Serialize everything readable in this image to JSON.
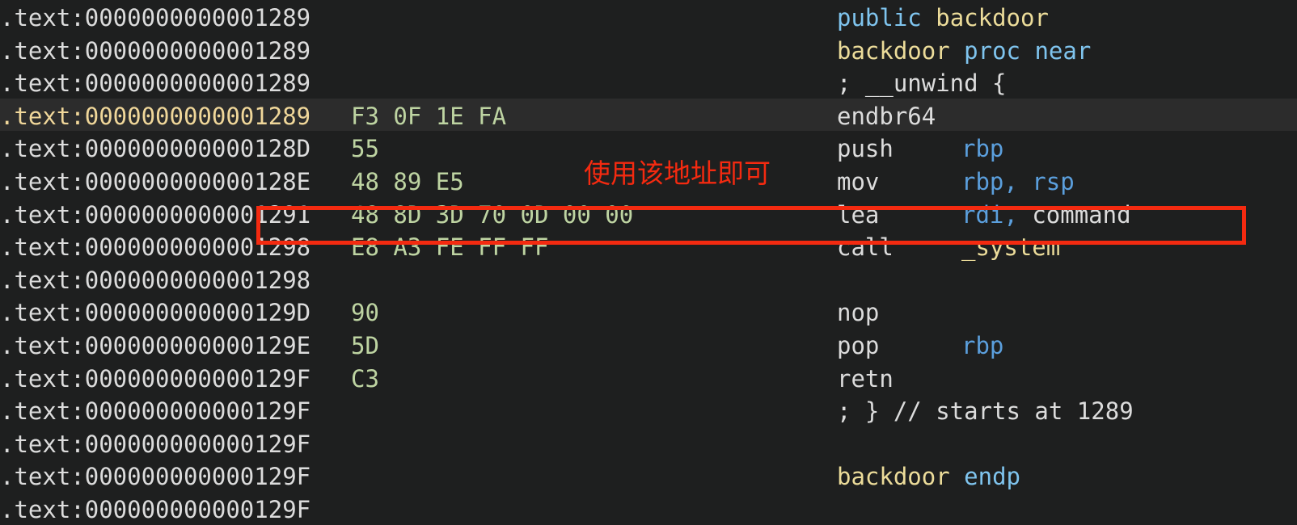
{
  "app": {
    "title": "IDA Pro disassembly view",
    "background_color": "#1e1f1f",
    "highlight_row_color": "#2c2c2c"
  },
  "annotation": {
    "text": "使用该地址即可",
    "color": "#f42a10",
    "box_color": "#f42a10",
    "box_target_line_index": 6
  },
  "colors": {
    "address": "#dcdcdc",
    "address_highlighted": "#f0d79a",
    "bytes": "#bed4a2",
    "keyword": "#7fc4ee",
    "symbol_name": "#ecdc9a",
    "register": "#5b9fdd",
    "plain": "#dcdcdc"
  },
  "listing": {
    "segment": ".text",
    "rows": [
      {
        "address": ".text:0000000000001289",
        "bytes": "",
        "mnemonic": "",
        "highlighted": false,
        "tokens": [
          {
            "t": "public",
            "c": "kw"
          },
          {
            "t": " ",
            "c": "plain"
          },
          {
            "t": "backdoor",
            "c": "name"
          }
        ]
      },
      {
        "address": ".text:0000000000001289",
        "bytes": "",
        "mnemonic": "",
        "highlighted": false,
        "tokens": [
          {
            "t": "backdoor",
            "c": "name"
          },
          {
            "t": " ",
            "c": "plain"
          },
          {
            "t": "proc near",
            "c": "kw"
          }
        ]
      },
      {
        "address": ".text:0000000000001289",
        "bytes": "",
        "mnemonic": "",
        "highlighted": false,
        "tokens": [
          {
            "t": "; __unwind {",
            "c": "comment"
          }
        ]
      },
      {
        "address": ".text:0000000000001289",
        "bytes": "F3 0F 1E FA",
        "mnemonic": "endbr64",
        "highlighted": true,
        "tokens": []
      },
      {
        "address": ".text:000000000000128D",
        "bytes": "55",
        "mnemonic": "push",
        "highlighted": false,
        "tokens": [
          {
            "t": "rbp",
            "c": "reg"
          }
        ]
      },
      {
        "address": ".text:000000000000128E",
        "bytes": "48 89 E5",
        "mnemonic": "mov",
        "highlighted": false,
        "tokens": [
          {
            "t": "rbp, rsp",
            "c": "reg"
          }
        ]
      },
      {
        "address": ".text:0000000000001291",
        "bytes": "48 8D 3D 70 0D 00 00",
        "mnemonic": "lea",
        "highlighted": false,
        "tokens": [
          {
            "t": "rdi",
            "c": "reg"
          },
          {
            "t": ", ",
            "c": "reg"
          },
          {
            "t": "command",
            "c": "plain"
          }
        ]
      },
      {
        "address": ".text:0000000000001298",
        "bytes": "E8 A3 FE FF FF",
        "mnemonic": "call",
        "highlighted": false,
        "tokens": [
          {
            "t": "_system",
            "c": "name"
          }
        ]
      },
      {
        "address": ".text:0000000000001298",
        "bytes": "",
        "mnemonic": "",
        "highlighted": false,
        "tokens": []
      },
      {
        "address": ".text:000000000000129D",
        "bytes": "90",
        "mnemonic": "nop",
        "highlighted": false,
        "tokens": []
      },
      {
        "address": ".text:000000000000129E",
        "bytes": "5D",
        "mnemonic": "pop",
        "highlighted": false,
        "tokens": [
          {
            "t": "rbp",
            "c": "reg"
          }
        ]
      },
      {
        "address": ".text:000000000000129F",
        "bytes": "C3",
        "mnemonic": "retn",
        "highlighted": false,
        "tokens": []
      },
      {
        "address": ".text:000000000000129F",
        "bytes": "",
        "mnemonic": "",
        "highlighted": false,
        "tokens": [
          {
            "t": "; } // starts at 1289",
            "c": "comment"
          }
        ]
      },
      {
        "address": ".text:000000000000129F",
        "bytes": "",
        "mnemonic": "",
        "highlighted": false,
        "tokens": []
      },
      {
        "address": ".text:000000000000129F",
        "bytes": "",
        "mnemonic": "",
        "highlighted": false,
        "tokens": [
          {
            "t": "backdoor",
            "c": "name"
          },
          {
            "t": " ",
            "c": "plain"
          },
          {
            "t": "endp",
            "c": "kw"
          }
        ]
      },
      {
        "address": ".text:000000000000129F",
        "bytes": "",
        "mnemonic": "",
        "highlighted": false,
        "tokens": []
      }
    ]
  }
}
